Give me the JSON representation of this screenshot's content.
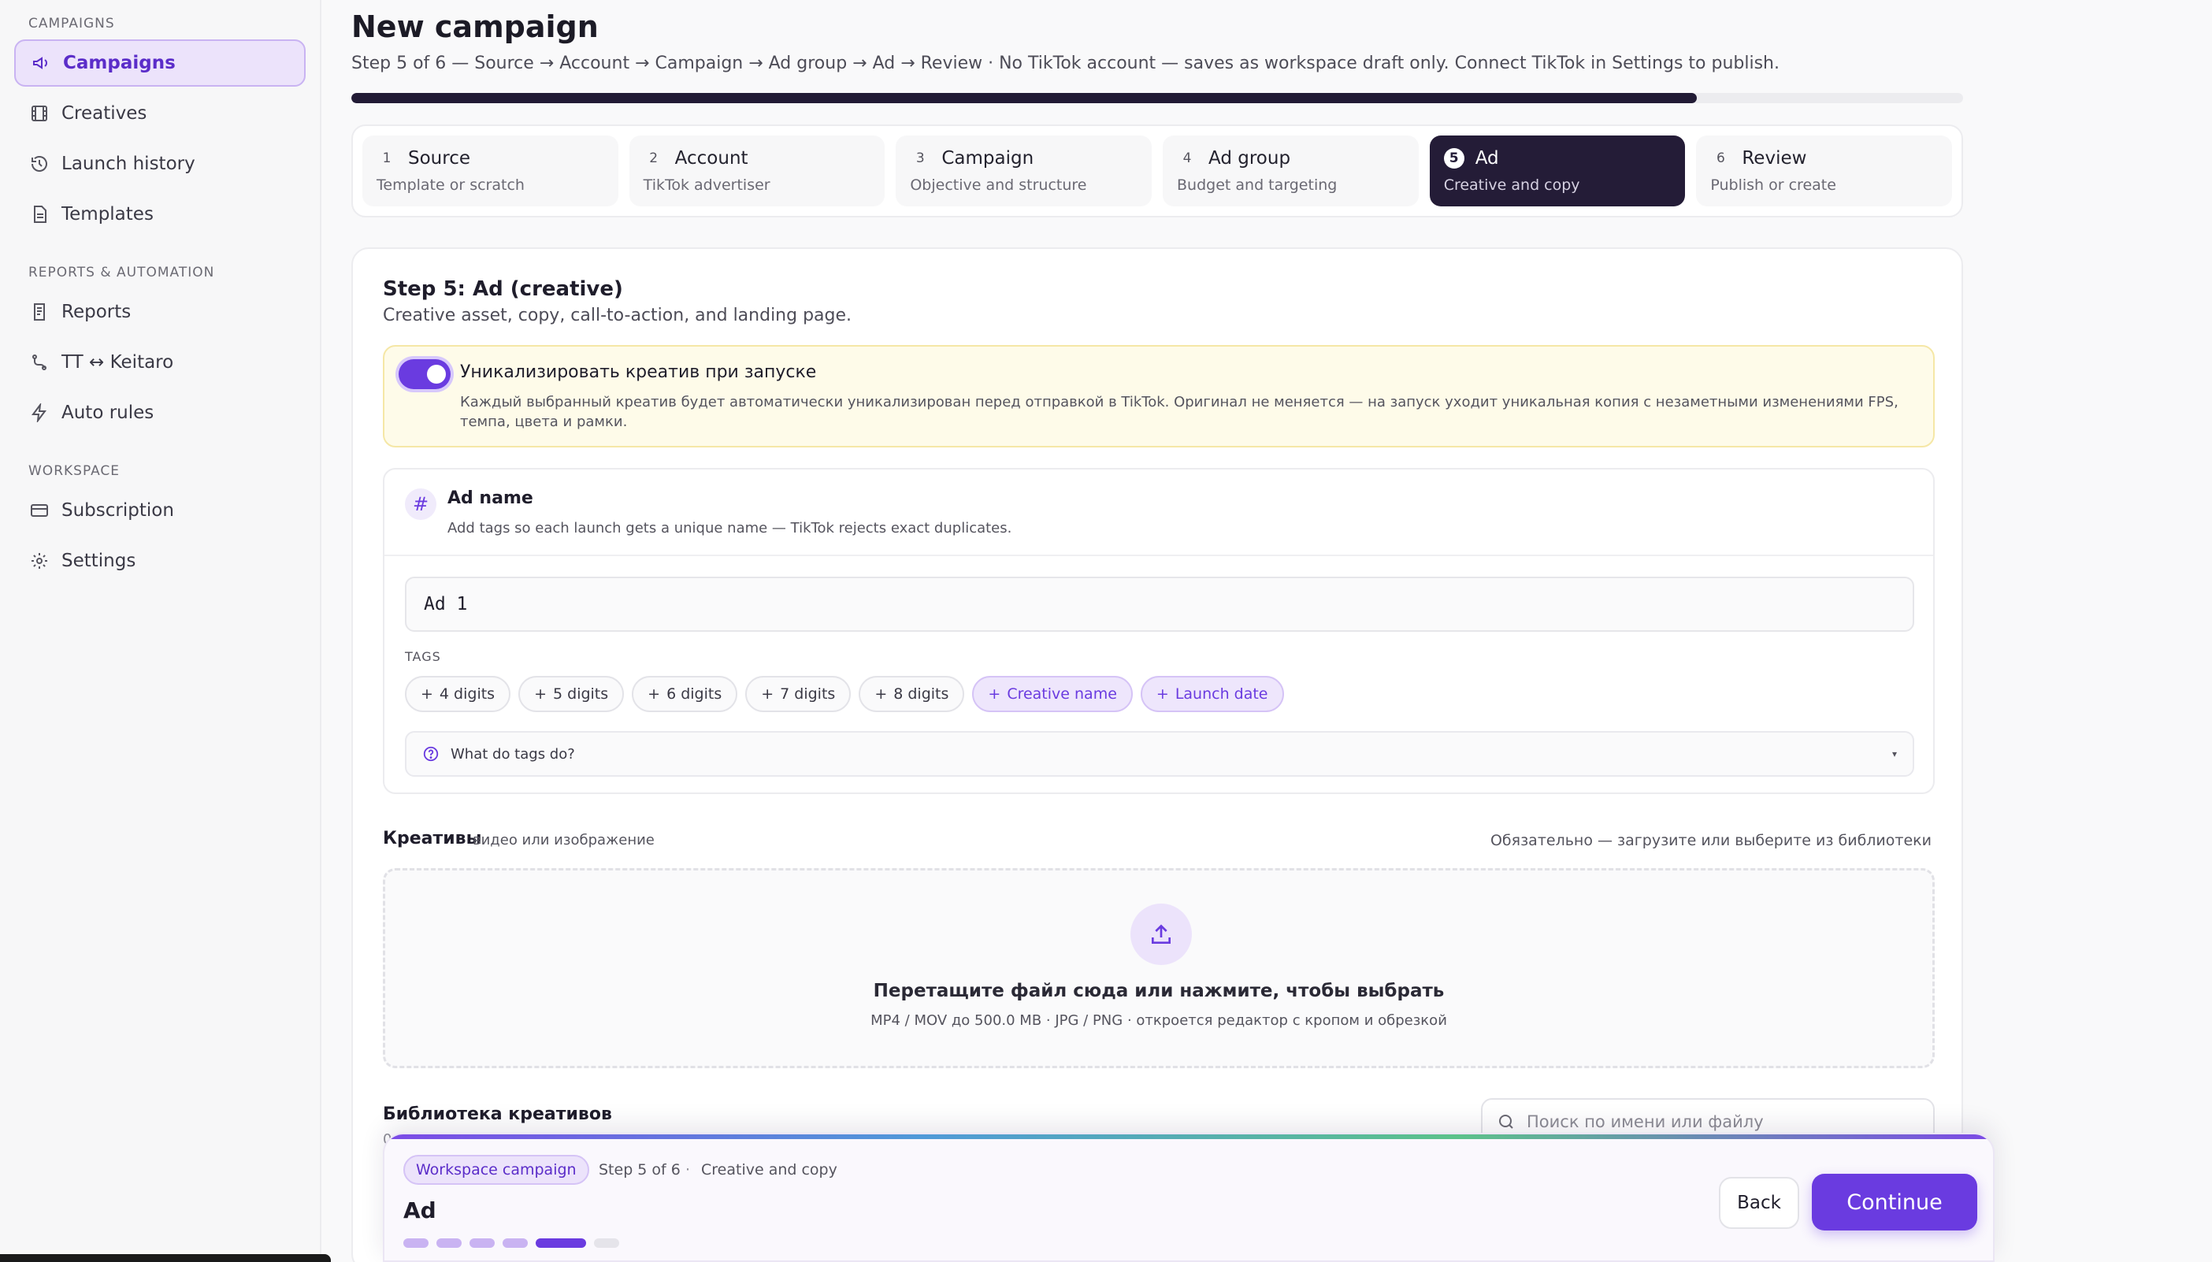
{
  "sidebar": {
    "sections": [
      {
        "title": "CAMPAIGNS",
        "items": [
          {
            "label": "Campaigns",
            "icon": "megaphone-icon",
            "active": true
          },
          {
            "label": "Creatives",
            "icon": "film-icon"
          },
          {
            "label": "Launch history",
            "icon": "history-icon"
          },
          {
            "label": "Templates",
            "icon": "file-icon"
          }
        ]
      },
      {
        "title": "REPORTS & AUTOMATION",
        "items": [
          {
            "label": "Reports",
            "icon": "report-icon"
          },
          {
            "label": "TT ↔ Keitaro",
            "icon": "route-icon"
          },
          {
            "label": "Auto rules",
            "icon": "bolt-icon"
          }
        ]
      },
      {
        "title": "WORKSPACE",
        "items": [
          {
            "label": "Subscription",
            "icon": "card-icon"
          },
          {
            "label": "Settings",
            "icon": "gear-icon"
          }
        ]
      }
    ]
  },
  "page": {
    "title": "New campaign",
    "subtitle": "Step 5 of 6 — Source → Account → Campaign → Ad group → Ad → Review · No TikTok account — saves as workspace draft only. Connect TikTok in Settings to publish.",
    "progress_fraction": 0.835
  },
  "steps": [
    {
      "num": "1",
      "name": "Source",
      "desc": "Template or scratch"
    },
    {
      "num": "2",
      "name": "Account",
      "desc": "TikTok advertiser"
    },
    {
      "num": "3",
      "name": "Campaign",
      "desc": "Objective and structure"
    },
    {
      "num": "4",
      "name": "Ad group",
      "desc": "Budget and targeting"
    },
    {
      "num": "5",
      "name": "Ad",
      "desc": "Creative and copy",
      "active": true
    },
    {
      "num": "6",
      "name": "Review",
      "desc": "Publish or create"
    }
  ],
  "card": {
    "title": "Step 5: Ad (creative)",
    "subtitle": "Creative asset, copy, call-to-action, and landing page.",
    "uniq": {
      "enabled": true,
      "title": "Уникализировать креатив при запуске",
      "text": "Каждый выбранный креатив будет автоматически уникализирован перед отправкой в TikTok. Оригинал не меняется — на запуск уходит уникальная копия с незаметными изменениями FPS, темпа, цвета и рамки."
    },
    "ad_name": {
      "title": "Ad name",
      "subtitle": "Add tags so each launch gets a unique name — TikTok rejects exact duplicates.",
      "value": "Ad 1",
      "tags_label": "TAGS",
      "tags": [
        "4 digits",
        "5 digits",
        "6 digits",
        "7 digits",
        "8 digits",
        "Creative name",
        "Launch date"
      ],
      "help": "What do tags do?"
    },
    "creatives": {
      "title": "Креативы",
      "hint": "видео или изображение",
      "required": "Обязательно — загрузите или выберите из библиотеки",
      "drop_title": "Перетащите файл сюда или нажмите, чтобы выбрать",
      "drop_sub": "MP4 / MOV до 500.0 MB · JPG / PNG · откроется редактор с кропом и обрезкой"
    },
    "library": {
      "title": "Библиотека креативов",
      "count": "0",
      "search_placeholder": "Поиск по имени или файлу"
    }
  },
  "footer": {
    "badge": "Workspace campaign",
    "step": "Step 5 of 6",
    "sep": "·",
    "desc": "Creative and copy",
    "title": "Ad",
    "pips_total": 6,
    "pips_current": 5,
    "back": "Back",
    "continue": "Continue"
  },
  "colors": {
    "accent": "#6a3be0",
    "dark": "#241c37",
    "notice_bg": "#fefbe9"
  }
}
